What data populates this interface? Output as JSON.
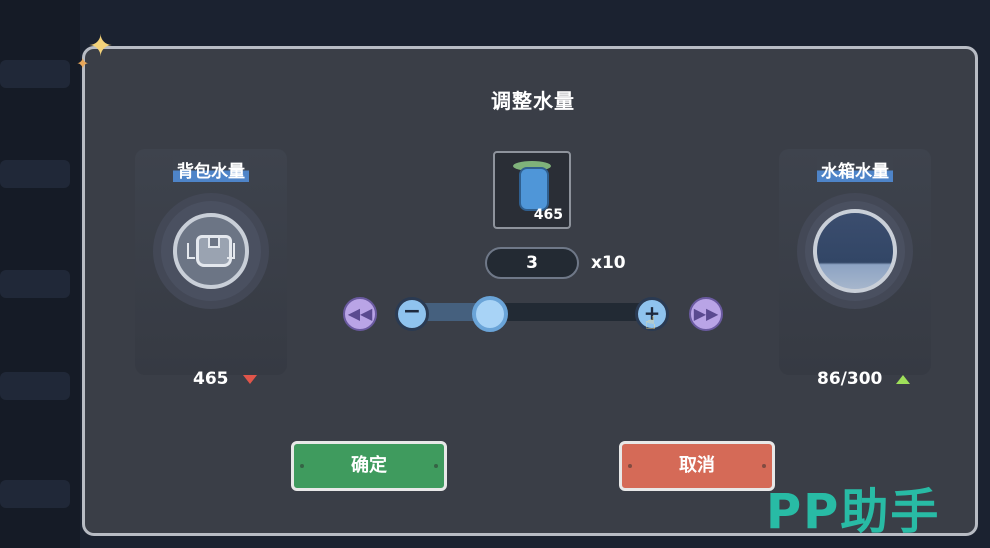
{
  "dialog": {
    "title": "调整水量",
    "backpack": {
      "label": "背包水量",
      "amount": "465"
    },
    "tank": {
      "label": "水箱水量",
      "amount": "86/300"
    },
    "item": {
      "count": "465"
    },
    "quantity": {
      "value": "3",
      "multiplier": "x10"
    },
    "slider": {
      "fraction": 0.3
    },
    "confirm_label": "确定",
    "cancel_label": "取消"
  },
  "watermark": "PP助手",
  "colors": {
    "confirm": "#3f9b5e",
    "cancel": "#d56a57",
    "decrease_indicator": "#e0554a",
    "increase_indicator": "#9fe05a"
  },
  "icons": [
    "sparkle-icon",
    "backpack-icon",
    "water-tank-icon",
    "water-bottle-icon",
    "rewind-icon",
    "fast-forward-icon",
    "minus-icon",
    "plus-icon",
    "hand-cursor-icon"
  ]
}
